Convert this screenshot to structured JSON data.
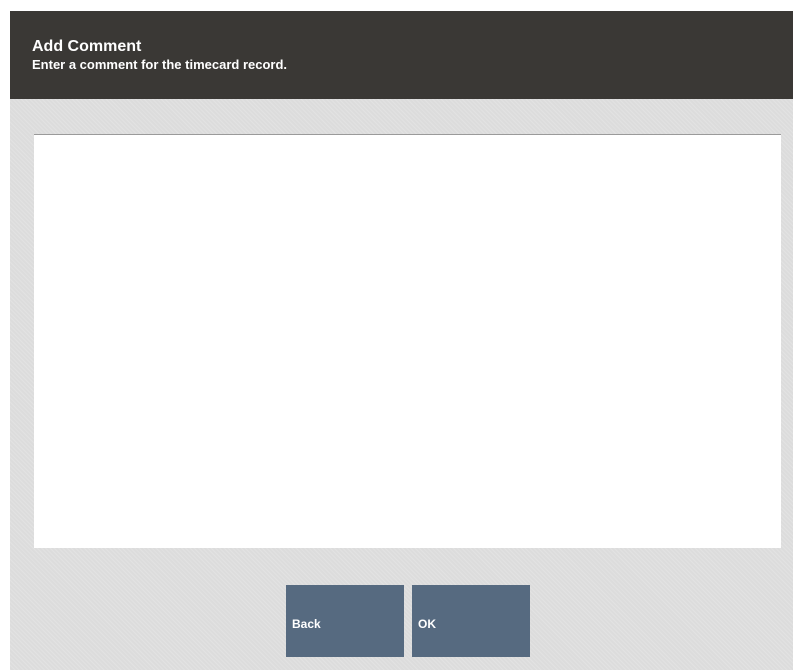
{
  "header": {
    "title": "Add Comment",
    "subtitle": "Enter a comment for the timecard record."
  },
  "comment": {
    "value": "",
    "placeholder": ""
  },
  "buttons": {
    "back_label": "Back",
    "ok_label": "OK"
  },
  "colors": {
    "header_bg": "#3a3835",
    "body_bg": "#dcdcdc",
    "button_bg": "#566a80",
    "input_bg": "#ffffff"
  }
}
